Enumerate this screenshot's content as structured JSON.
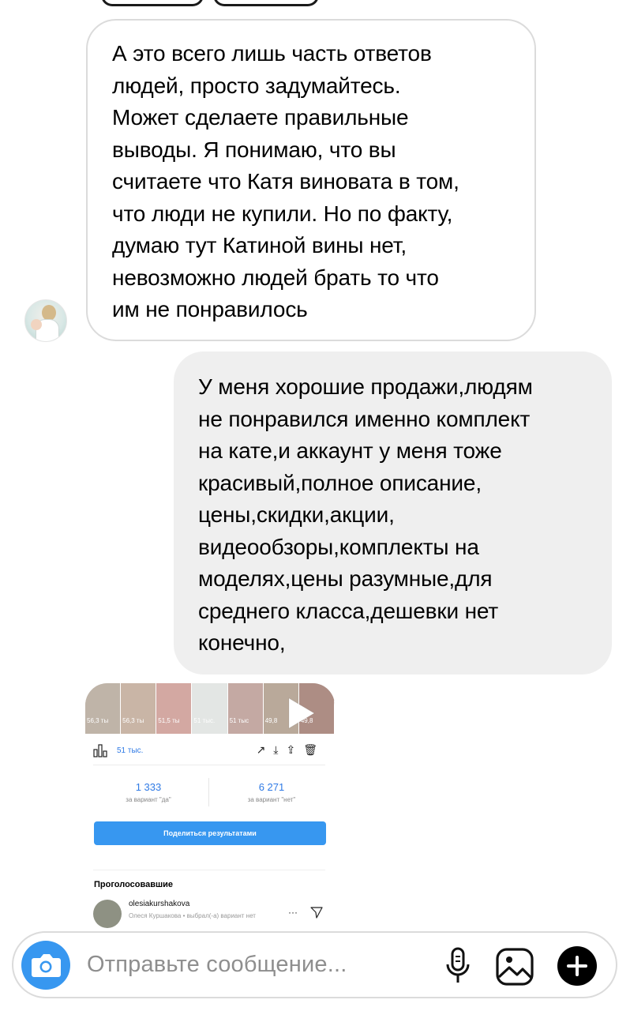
{
  "messages": [
    {
      "direction": "incoming",
      "text": "А это всего лишь часть ответов\nлюдей, просто задумайтесь.\nМожет сделаете правильные\nвыводы. Я понимаю, что вы\nсчитаете что Катя виновата в том,\nчто люди не купили. Но по факту,\nдумаю тут Катиной вины нет,\nневозможно людей брать то что\nим не понравилось"
    },
    {
      "direction": "outgoing",
      "text": "У меня хорошие продажи,людям\nне понравился именно комплект\nна кате,и аккаунт у меня тоже\nкрасивый,полное описание,\nцены,скидки,акции,\nвидеообзоры,комплекты на\nмоделях,цены разумные,для\nсреднего класса,дешевки нет\nконечно,"
    }
  ],
  "attachment": {
    "thumb_views": [
      "56,3 ты",
      "56,3 ты",
      "51,5 ты",
      "51 тыс.",
      "51 тыс",
      "49,8",
      "49,8"
    ],
    "views": "51 тыс.",
    "stats": [
      {
        "value": "1 333",
        "label": "за вариант \"да\""
      },
      {
        "value": "6 271",
        "label": "за вариант \"нет\""
      }
    ],
    "share_button": "Поделиться результатами",
    "voters_title": "Проголосовавшие",
    "voter": {
      "username": "olesiakurshakova",
      "detail": "Олеся Куршакова • выбрал(-а) вариант нет"
    }
  },
  "composer": {
    "placeholder": "Отправьте сообщение..."
  },
  "icons": {
    "camera": "camera-icon",
    "mic": "microphone-icon",
    "gallery": "gallery-icon",
    "plus": "plus-icon",
    "play": "play-icon"
  },
  "colors": {
    "accent": "#3797f0",
    "incoming_border": "#dbdbdb",
    "outgoing_bg": "#efefef"
  }
}
